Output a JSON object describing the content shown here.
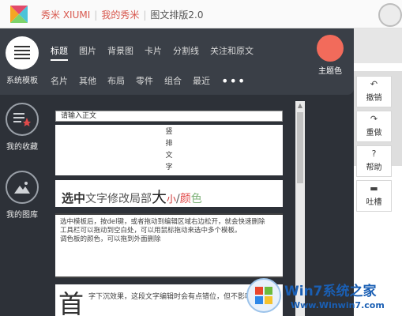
{
  "breadcrumb": {
    "items": [
      "秀米 XIUMI",
      "我的秀米",
      "图文排版2.0"
    ]
  },
  "sidebar": {
    "items": [
      {
        "label": "系统模板"
      },
      {
        "label": "我的收藏"
      },
      {
        "label": "我的图库"
      }
    ]
  },
  "tabs": {
    "row1": [
      "标题",
      "图片",
      "背景图",
      "卡片",
      "分割线",
      "关注和原文"
    ],
    "row2": [
      "名片",
      "其他",
      "布局",
      "零件",
      "组合",
      "最近"
    ],
    "more": "•••"
  },
  "theme": {
    "label": "主题色",
    "color": "#f26b5b"
  },
  "templates": {
    "input_placeholder": "请输入正文",
    "vertical_text": [
      "竖",
      "排",
      "文",
      "字"
    ],
    "heading": {
      "bold": "选中",
      "mid": "文字修改局部",
      "big": "大",
      "small": "小",
      "slash": "/",
      "color1": "颜",
      "color2": "色"
    },
    "tips": [
      "选中模板后，按del键，或者拖动到编辑区域右边松开，就会快速删除",
      "工具栏可以拖动到空白处，可以用鼠标拖动来选中多个模板。",
      "调色板的颜色，可以拖到外面删除"
    ],
    "dropcap_char": "首",
    "dropcap_text": "字下沉效果，这段文字编辑时会有点错位，但不影响"
  },
  "actions": [
    {
      "label": "撤销",
      "icon": "undo-icon"
    },
    {
      "label": "重做",
      "icon": "redo-icon"
    },
    {
      "label": "帮助",
      "icon": "help-icon"
    },
    {
      "label": "吐槽",
      "icon": "chat-icon"
    }
  ],
  "watermark": {
    "title": "Win7系统之家",
    "url": "Www.Winwin7.com"
  },
  "colors": {
    "accent": "#d8584e",
    "panel": "#2d3138",
    "theme": "#f26b5b"
  }
}
